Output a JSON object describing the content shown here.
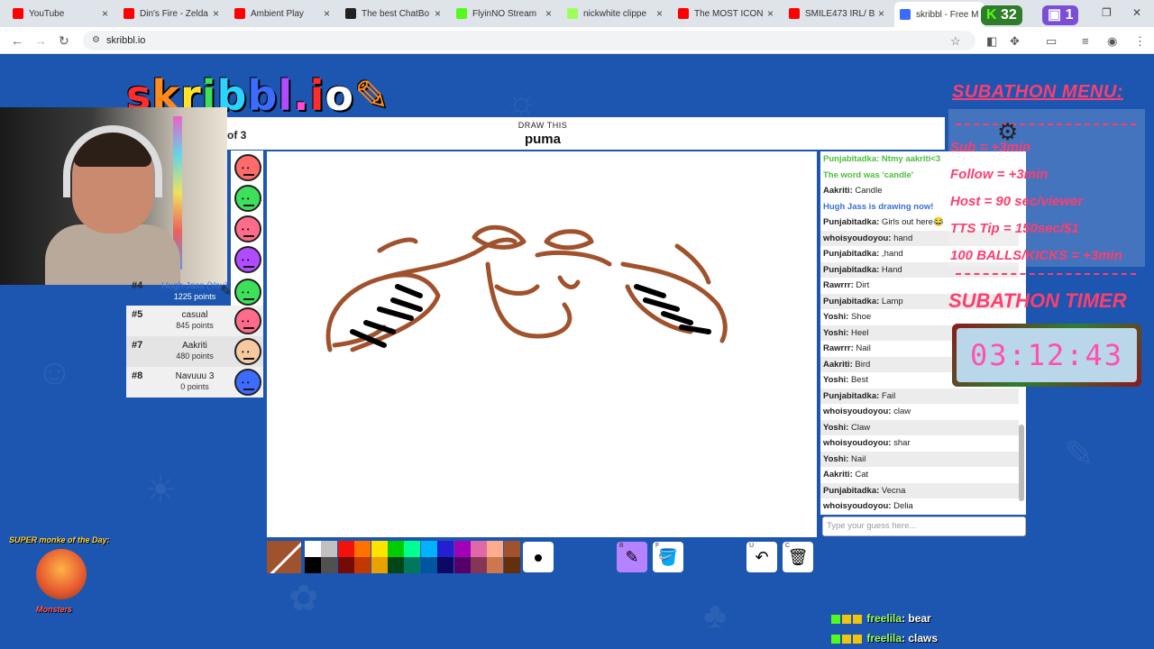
{
  "browser": {
    "tabs": [
      {
        "label": "YouTube",
        "color": "#ff0000"
      },
      {
        "label": "Din's Fire - Zelda",
        "color": "#ff0000"
      },
      {
        "label": "Ambient Play",
        "color": "#ff0000"
      },
      {
        "label": "The best ChatBo",
        "color": "#222222"
      },
      {
        "label": "FlyinNO Stream",
        "color": "#53fc18"
      },
      {
        "label": "nickwhite clippe",
        "color": "#9dff5a"
      },
      {
        "label": "The MOST ICON",
        "color": "#ff0000"
      },
      {
        "label": "SMILE473 IRL/ B",
        "color": "#ff0000"
      },
      {
        "label": "skribbl - Free M",
        "color": "#3b6bff"
      }
    ],
    "url": "skribbl.io"
  },
  "stream_counters": {
    "kick": "32",
    "twitch": "1"
  },
  "logo_letters": [
    "s",
    "k",
    "r",
    "i",
    "b",
    "b",
    "l",
    ".",
    "i",
    "o",
    "✎"
  ],
  "round": {
    "text": "of 3",
    "draw_label": "DRAW THIS",
    "word": "puma"
  },
  "players": [
    {
      "rank": "#4",
      "name": "Hugh Jass (You)",
      "points": "1225 points",
      "face": "#3de05a"
    },
    {
      "rank": "#5",
      "name": "casual",
      "points": "845 points",
      "face": "#ff6b8a"
    },
    {
      "rank": "#7",
      "name": "Aakriti",
      "points": "480 points",
      "face": "#f6c9a0"
    },
    {
      "rank": "#8",
      "name": "Navuuu 3",
      "points": "0 points",
      "face": "#3b6bff"
    }
  ],
  "avatar_faces": [
    "#ff6b6b",
    "#3de05a",
    "#ff6b8a",
    "#b04bff",
    "#3de05a"
  ],
  "chat": [
    {
      "user": "",
      "text": "Punjabitadka: Ntmy aakriti<3",
      "style": "green"
    },
    {
      "user": "",
      "text": "The word was 'candle'",
      "style": "green"
    },
    {
      "user": "Aakriti:",
      "text": " Candle",
      "style": ""
    },
    {
      "user": "",
      "text": "Hugh Jass is drawing now!",
      "style": "blue"
    },
    {
      "user": "Punjabitadka:",
      "text": " Girls out here😂",
      "style": ""
    },
    {
      "user": "whoisyoudoyou:",
      "text": " hand",
      "style": ""
    },
    {
      "user": "Punjabitadka:",
      "text": " ,hand",
      "style": ""
    },
    {
      "user": "Punjabitadka:",
      "text": " Hand",
      "style": ""
    },
    {
      "user": "Rawrrr:",
      "text": " Dirt",
      "style": ""
    },
    {
      "user": "Punjabitadka:",
      "text": " Lamp",
      "style": ""
    },
    {
      "user": "Yoshi:",
      "text": " Shoe",
      "style": ""
    },
    {
      "user": "Yoshi:",
      "text": " Heel",
      "style": ""
    },
    {
      "user": "Rawrrr:",
      "text": " Nail",
      "style": ""
    },
    {
      "user": "Aakriti:",
      "text": " Bird",
      "style": ""
    },
    {
      "user": "Yoshi:",
      "text": " Best",
      "style": ""
    },
    {
      "user": "Punjabitadka:",
      "text": " Fail",
      "style": ""
    },
    {
      "user": "whoisyoudoyou:",
      "text": " claw",
      "style": ""
    },
    {
      "user": "Yoshi:",
      "text": " Claw",
      "style": ""
    },
    {
      "user": "whoisyoudoyou:",
      "text": " shar",
      "style": ""
    },
    {
      "user": "Yoshi:",
      "text": " Nail",
      "style": ""
    },
    {
      "user": "Aakriti:",
      "text": " Cat",
      "style": ""
    },
    {
      "user": "Punjabitadka:",
      "text": " Vecna",
      "style": ""
    },
    {
      "user": "whoisyoudoyou:",
      "text": " Delia",
      "style": ""
    }
  ],
  "guess_placeholder": "Type your guess here...",
  "palette": [
    "#ffffff",
    "#c1c1c1",
    "#ef130b",
    "#ff7100",
    "#ffe400",
    "#00cc00",
    "#00ff91",
    "#00b2ff",
    "#231fd3",
    "#a300ba",
    "#df69a7",
    "#ffac8e",
    "#a0522d",
    "#000000",
    "#505050",
    "#740b07",
    "#c23800",
    "#e8a200",
    "#004619",
    "#00785d",
    "#00569e",
    "#0e0865",
    "#550069",
    "#873554",
    "#cc774d",
    "#63300d"
  ],
  "current_color": "#a0522d",
  "tools": [
    {
      "key": "B",
      "name": "pencil",
      "glyph": "✎",
      "selected": true
    },
    {
      "key": "F",
      "name": "fill",
      "glyph": "🪣",
      "selected": false
    },
    {
      "key": "U",
      "name": "undo",
      "glyph": "↶",
      "selected": false
    },
    {
      "key": "C",
      "name": "clear",
      "glyph": "🗑",
      "selected": false
    }
  ],
  "subathon": {
    "menu_title": "SUBATHON MENU:",
    "lines": [
      "Sub = +3min",
      "Follow = +3min",
      "Host = 90 sec/viewer",
      "TTS Tip = 150sec/$1",
      "100 BALLS/KICKS = +3min"
    ],
    "timer_title": "SUBATHON TIMER",
    "timer": "03:12:43"
  },
  "monke": {
    "title": "SUPER monke of the Day:",
    "name": "Monsters"
  },
  "twitch_chat": [
    {
      "user": "freelila",
      "text": ": bear"
    },
    {
      "user": "freelila",
      "text": ": claws"
    }
  ]
}
